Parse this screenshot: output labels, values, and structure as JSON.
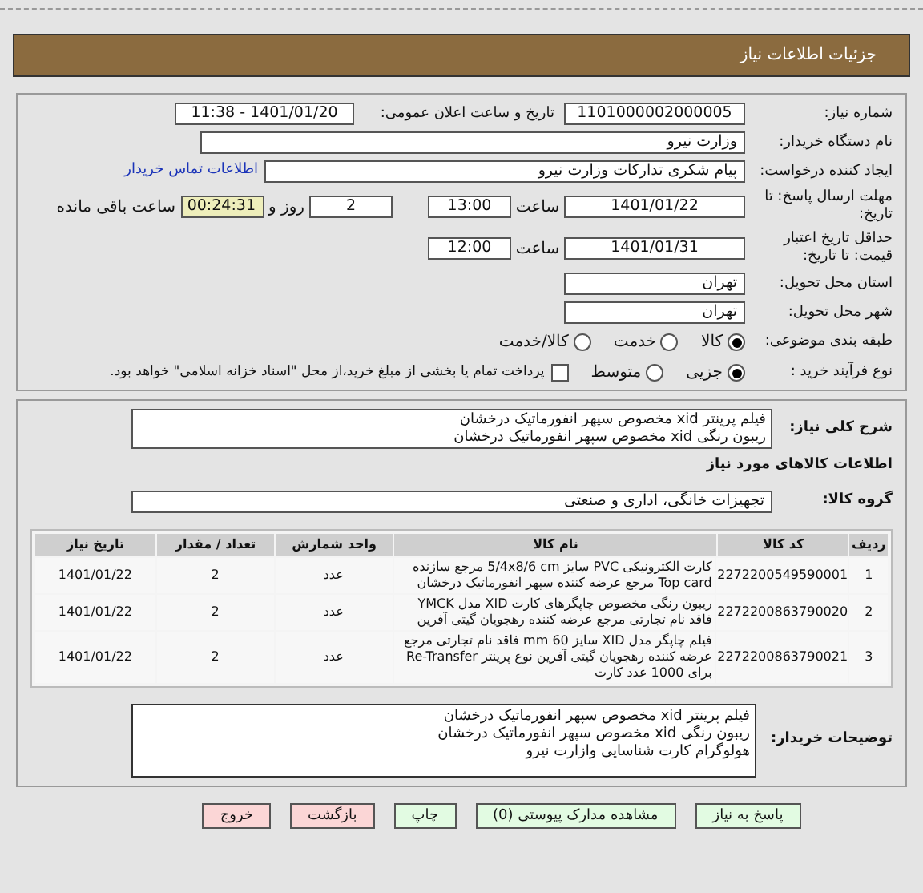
{
  "header": {
    "title": "جزئیات اطلاعات نیاز"
  },
  "need_number": {
    "label": "شماره نیاز:",
    "value": "1101000002000005"
  },
  "announce": {
    "label": "تاریخ و ساعت اعلان عمومی:",
    "value": "1401/01/20 - 11:38"
  },
  "buyer_org": {
    "label": "نام دستگاه خریدار:",
    "value": "وزارت نیرو"
  },
  "requester": {
    "label": "ایجاد کننده درخواست:",
    "value": "پیام شکری تدارکات وزارت نیرو",
    "link": "اطلاعات تماس خریدار"
  },
  "deadline": {
    "label": "مهلت ارسال پاسخ: تا تاریخ:",
    "date": "1401/01/22",
    "time_label": "ساعت",
    "time": "13:00",
    "days": "2",
    "days_label": "روز و",
    "remaining": "00:24:31",
    "remaining_label": "ساعت باقی مانده"
  },
  "price_validity": {
    "label": "حداقل تاریخ اعتبار قیمت: تا تاریخ:",
    "date": "1401/01/31",
    "time_label": "ساعت",
    "time": "12:00"
  },
  "province": {
    "label": "استان محل تحویل:",
    "value": "تهران"
  },
  "city": {
    "label": "شهر محل تحویل:",
    "value": "تهران"
  },
  "category": {
    "label": "طبقه بندی موضوعی:",
    "options": [
      {
        "label": "کالا",
        "selected": true
      },
      {
        "label": "خدمت",
        "selected": false
      },
      {
        "label": "کالا/خدمت",
        "selected": false
      }
    ]
  },
  "process": {
    "label": "نوع فرآیند خرید :",
    "options": [
      {
        "label": "جزیی",
        "selected": true
      },
      {
        "label": "متوسط",
        "selected": false
      }
    ],
    "treasury": {
      "label": "پرداخت تمام یا بخشی از مبلغ خرید،از محل \"اسناد خزانه اسلامی\" خواهد بود.",
      "checked": false
    }
  },
  "summary": {
    "label": "شرح کلی نیاز:",
    "lines": [
      "فیلم پرینتر xid مخصوص سپهر انفورماتیک درخشان",
      "ریبون رنگی xid مخصوص سپهر انفورماتیک درخشان"
    ]
  },
  "goods_title": "اطلاعات کالاهای مورد نیاز",
  "goods_group": {
    "label": "گروه کالا:",
    "value": "تجهیزات خانگی، اداری و صنعتی"
  },
  "table": {
    "columns": [
      "ردیف",
      "کد کالا",
      "نام کالا",
      "واحد شمارش",
      "تعداد / مقدار",
      "تاریخ نیاز"
    ],
    "rows": [
      [
        "1",
        "2272200549590001",
        "کارت الکترونیکی PVC سایز 5/4x8/6 cm مرجع سازنده Top card مرجع عرضه کننده سپهر انفورماتیک درخشان",
        "عدد",
        "2",
        "1401/01/22"
      ],
      [
        "2",
        "2272200863790020",
        "ریبون رنگی مخصوص چاپگرهای کارت XID مدل YMCK فاقد نام تجارتی مرجع عرضه کننده رهجویان گیتی آفرین",
        "عدد",
        "2",
        "1401/01/22"
      ],
      [
        "3",
        "2272200863790021",
        "فیلم چاپگر مدل XID سایز 60 mm فاقد نام تجارتی مرجع عرضه کننده رهجویان گیتی آفرین نوع پرینتر Re-Transfer برای 1000 عدد کارت",
        "عدد",
        "2",
        "1401/01/22"
      ]
    ]
  },
  "buyer_notes": {
    "label": "توضیحات خریدار:",
    "lines": [
      "فیلم پرینتر xid مخصوص سپهر انفورماتیک درخشان",
      "ریبون رنگی xid مخصوص سپهر انفورماتیک درخشان",
      "هولوگرام کارت شناسایی وازارت نیرو"
    ]
  },
  "buttons": [
    {
      "label": "پاسخ به نیاز",
      "kind": "primary"
    },
    {
      "label": "مشاهده مدارک پیوستی (0)",
      "kind": "primary"
    },
    {
      "label": "چاپ",
      "kind": "primary"
    },
    {
      "label": "بازگشت",
      "kind": "danger"
    },
    {
      "label": "خروج",
      "kind": "danger"
    }
  ]
}
